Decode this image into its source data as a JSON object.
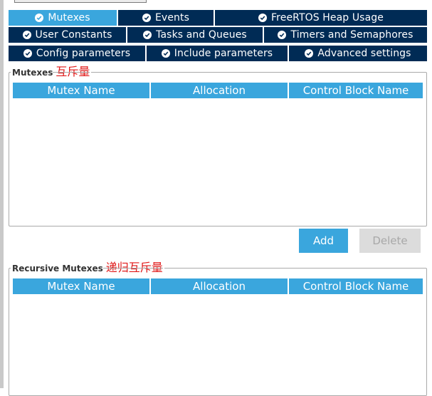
{
  "tabs": {
    "row1": [
      {
        "label": "Mutexes",
        "active": true
      },
      {
        "label": "Events",
        "active": false
      },
      {
        "label": "FreeRTOS Heap Usage",
        "active": false
      }
    ],
    "row2": [
      {
        "label": "User Constants"
      },
      {
        "label": "Tasks and Queues"
      },
      {
        "label": "Timers and Semaphores"
      }
    ],
    "row3": [
      {
        "label": "Config parameters"
      },
      {
        "label": "Include parameters"
      },
      {
        "label": "Advanced settings"
      }
    ]
  },
  "mutexes": {
    "legend": "Mutexes",
    "annotation": "互斥量",
    "columns": [
      "Mutex Name",
      "Allocation",
      "Control Block Name"
    ],
    "rows": []
  },
  "buttons": {
    "add": "Add",
    "delete": "Delete"
  },
  "recursive": {
    "legend": "Recursive Mutexes",
    "annotation": "递归互斥量",
    "columns": [
      "Mutex Name",
      "Allocation",
      "Control Block Name"
    ],
    "rows": []
  },
  "colors": {
    "tab_dark": "#002b55",
    "tab_active": "#3aa6dd",
    "header_blue": "#3aa6dd",
    "annotation_red": "#e01818",
    "disabled_button": "#dcdcdc"
  }
}
